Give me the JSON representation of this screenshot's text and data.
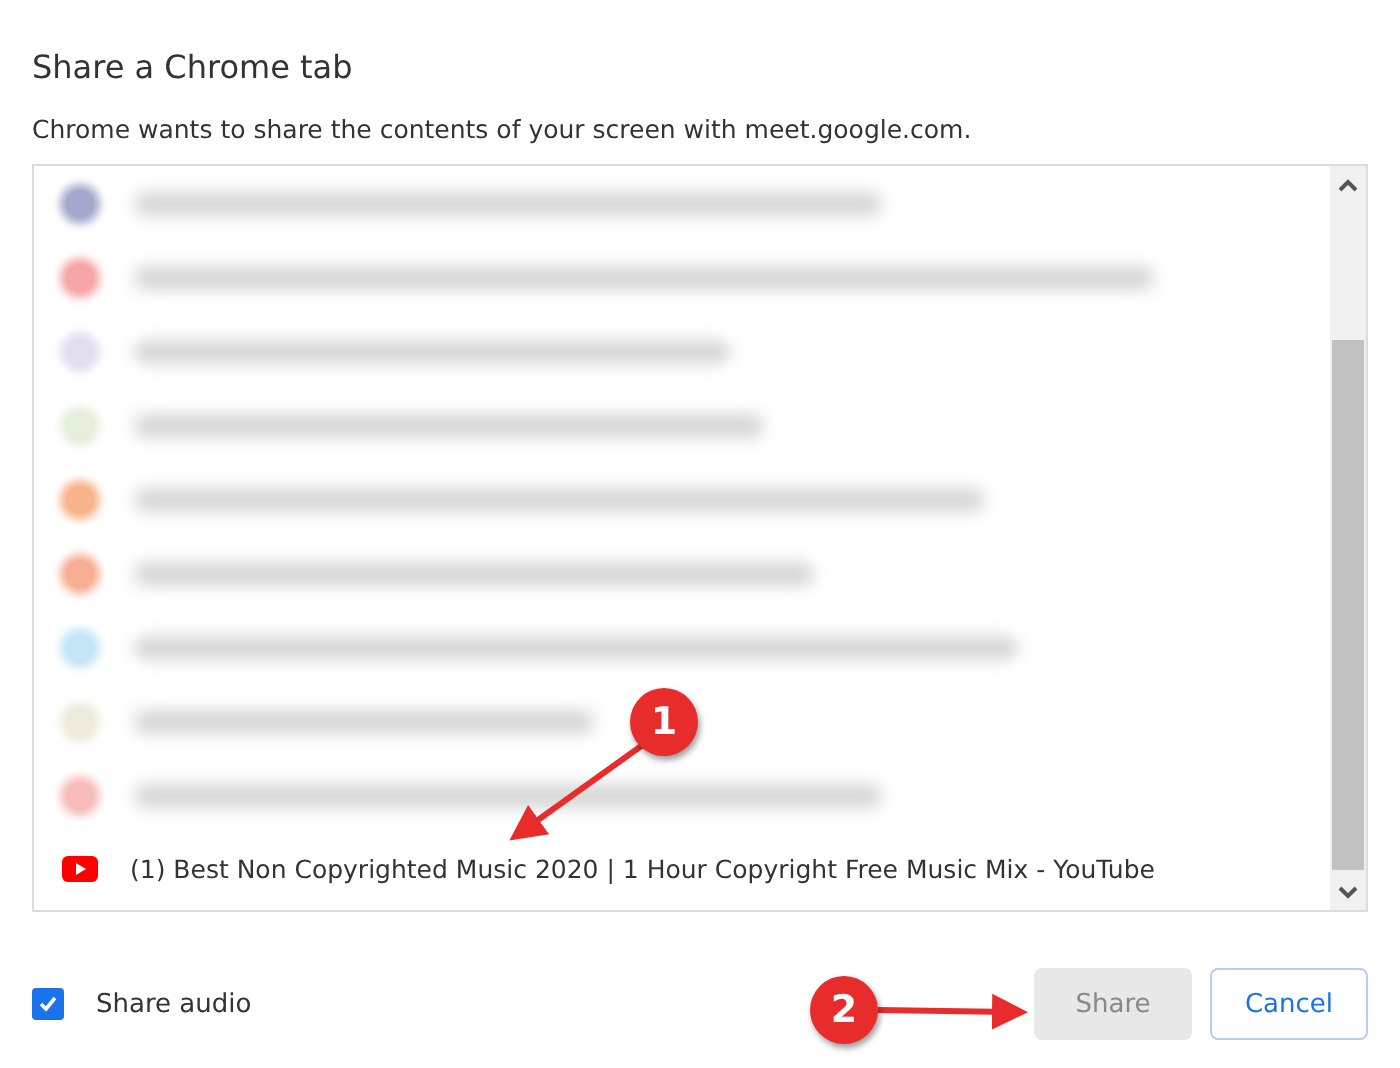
{
  "dialog": {
    "title": "Share a Chrome tab",
    "message": "Chrome wants to share the contents of your screen with meet.google.com."
  },
  "tabs": [
    {
      "kind": "blurred",
      "color": "#a4a8cc"
    },
    {
      "kind": "blurred",
      "color": "#f6a6a6"
    },
    {
      "kind": "blurred",
      "color": "#e2def0"
    },
    {
      "kind": "blurred",
      "color": "#e6eedc"
    },
    {
      "kind": "blurred",
      "color": "#f8b48c"
    },
    {
      "kind": "blurred",
      "color": "#f8ae94"
    },
    {
      "kind": "blurred",
      "color": "#c4e6f6"
    },
    {
      "kind": "blurred",
      "color": "#eeeadc"
    },
    {
      "kind": "blurred",
      "color": "#f8bcbc"
    },
    {
      "kind": "tab",
      "title": "(1) Best Non Copyrighted Music 2020 | 1 Hour Copyright Free Music Mix - YouTube"
    }
  ],
  "share_audio": {
    "label": "Share audio",
    "checked": true
  },
  "buttons": [
    {
      "label": "Share",
      "kind": "primary",
      "disabled": true
    },
    {
      "label": "Cancel",
      "kind": "secondary",
      "disabled": false
    }
  ],
  "callouts": [
    {
      "number": "1"
    },
    {
      "number": "2"
    }
  ]
}
